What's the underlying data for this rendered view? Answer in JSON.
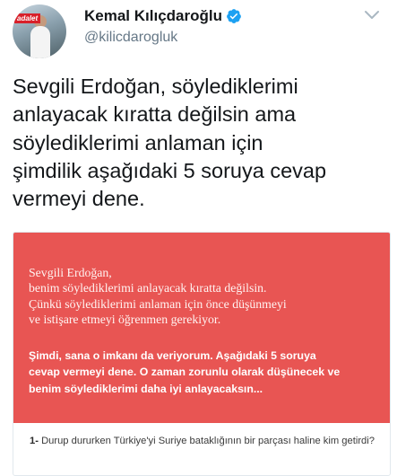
{
  "tweet": {
    "author_name": "Kemal Kılıçdaroğlu",
    "handle": "@kilicdarogluk",
    "avatar_badge": "adalet",
    "text": "Sevgili Erdoğan, söylediklerimi\nanlayacak kıratta değilsin ama\nsöylediklerimi anlaman için\nşimdilik aşağıdaki 5 soruya cevap\nvermeyi dene."
  },
  "card": {
    "letter": "Sevgili Erdoğan,\nbenim söylediklerimi anlayacak kıratta değilsin.\nÇünkü söylediklerimi anlaman için önce düşünmeyi\nve istişare etmeyi öğrenmen gerekiyor.",
    "bold_paragraph": "Şimdi, sana o imkanı da veriyorum. Aşağıdaki 5 soruya\ncevap vermeyi dene. O zaman zorunlu olarak düşünecek ve\nbenim söylediklerimi daha iyi anlayacaksın...",
    "question_number": "1-",
    "question_text": "Durup dururken Türkiye'yi Suriye bataklığının bir parçası haline kim getirdi?"
  },
  "colors": {
    "card_red": "#e85553",
    "verified_blue": "#1da1f2",
    "handle_gray": "#657786"
  },
  "icons": {
    "verified": "verified-badge-icon",
    "menu": "chevron-down-icon"
  }
}
